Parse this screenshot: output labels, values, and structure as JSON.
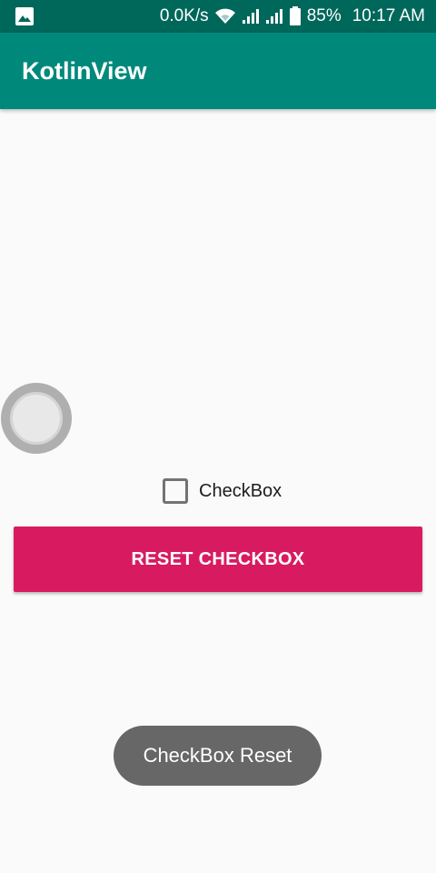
{
  "status_bar": {
    "left_icon": "image-icon",
    "network_speed": "0.0K/s",
    "wifi_icon": "wifi-icon",
    "signal_icons": [
      "signal-icon",
      "signal-icon"
    ],
    "battery_icon": "battery-icon",
    "battery_percent": "85%",
    "time": "10:17 AM"
  },
  "app_bar": {
    "title": "KotlinView",
    "color": "#00897b",
    "status_color": "#00675b"
  },
  "main": {
    "checkbox": {
      "label": "CheckBox",
      "checked": false
    },
    "reset_button": {
      "label": "RESET CHECKBOX",
      "color": "#d81b60"
    }
  },
  "toast": {
    "message": "CheckBox Reset"
  }
}
